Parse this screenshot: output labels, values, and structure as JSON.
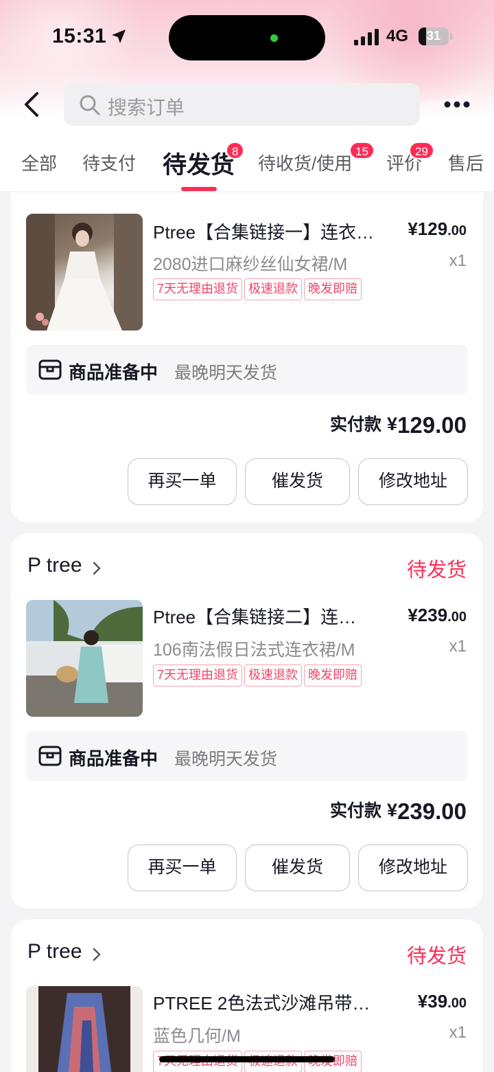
{
  "status_bar": {
    "time": "15:31",
    "network": "4G",
    "battery": "31"
  },
  "search": {
    "placeholder": "搜索订单"
  },
  "tabs": [
    {
      "label": "全部"
    },
    {
      "label": "待支付"
    },
    {
      "label": "待发货",
      "badge": "8",
      "active": true
    },
    {
      "label": "待收货/使用",
      "badge": "15"
    },
    {
      "label": "评价",
      "badge": "29"
    },
    {
      "label": "售后"
    }
  ],
  "orders": [
    {
      "product_title": "Ptree【合集链接一】连衣…",
      "price_main": "129",
      "price_cents": ".00",
      "spec": "2080进口麻纱丝仙女裙/M",
      "qty": "x1",
      "tags": [
        "7天无理由退货",
        "极速退款",
        "晚发即赔"
      ],
      "prep_title": "商品准备中",
      "prep_note": "最晚明天发货",
      "paid_label": "实付款",
      "paid_amount": "129.00",
      "buttons": [
        "再买一单",
        "催发货",
        "修改地址"
      ]
    },
    {
      "shop": "P tree",
      "status": "待发货",
      "product_title": "Ptree【合集链接二】连…",
      "price_main": "239",
      "price_cents": ".00",
      "spec": "106南法假日法式连衣裙/M",
      "qty": "x1",
      "tags": [
        "7天无理由退货",
        "极速退款",
        "晚发即赔"
      ],
      "prep_title": "商品准备中",
      "prep_note": "最晚明天发货",
      "paid_label": "实付款",
      "paid_amount": "239.00",
      "buttons": [
        "再买一单",
        "催发货",
        "修改地址"
      ]
    },
    {
      "shop": "P tree",
      "status": "待发货",
      "product_title": "PTREE 2色法式沙滩吊带…",
      "price_main": "39",
      "price_cents": ".00",
      "spec": "蓝色几何/M",
      "qty": "x1",
      "tags": [
        "7天无理由退货",
        "极速退款",
        "晚发即赔"
      ]
    }
  ],
  "currency_symbol": "¥",
  "colors": {
    "accent": "#fe2c55",
    "tag_text": "#f0466a",
    "tag_border": "#f5a3b4",
    "page_bg": "#f4f4f6"
  },
  "icons": [
    "location-arrow-icon",
    "signal-icon",
    "battery-icon",
    "back-icon",
    "search-icon",
    "more-icon",
    "chevron-right-icon",
    "package-box-icon"
  ]
}
